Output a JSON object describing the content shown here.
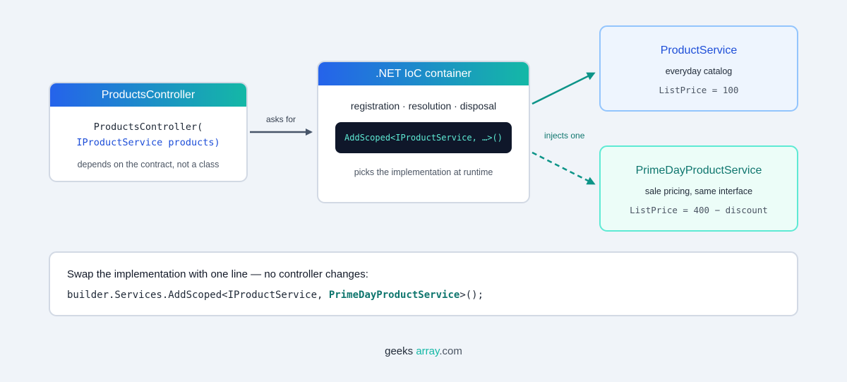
{
  "controller": {
    "title": "ProductsController",
    "signature_line1": "ProductsController(",
    "signature_line2": "IProductService products)",
    "note": "depends on the contract, not a class"
  },
  "arrows": {
    "asks_for": "asks for",
    "injects_one": "injects one"
  },
  "ioc": {
    "title": ".NET IoC container",
    "subtitle": "registration · resolution · disposal",
    "code": "AddScoped<IProductService, …>()",
    "note": "picks the implementation at runtime"
  },
  "product_service": {
    "name": "ProductService",
    "description": "everyday catalog",
    "price": "ListPrice = 100"
  },
  "prime_service": {
    "name": "PrimeDayProductService",
    "description": "sale pricing, same interface",
    "price": "ListPrice = 400 − discount"
  },
  "swap": {
    "title": "Swap the implementation with one line — no controller changes:",
    "code_prefix": "builder.Services.AddScoped<IProductService, ",
    "code_highlight": "PrimeDayProductService",
    "code_suffix": ">();"
  },
  "footer": {
    "part1": "geeks",
    "part2": "array",
    "part3": ".com"
  },
  "colors": {
    "gradient_start": "#2563eb",
    "gradient_end": "#14b8a6",
    "arrow_gray": "#475569",
    "arrow_teal": "#0d9488"
  }
}
